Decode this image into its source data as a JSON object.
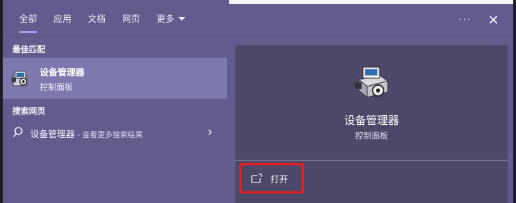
{
  "tabs": [
    {
      "label": "全部",
      "active": true
    },
    {
      "label": "应用"
    },
    {
      "label": "文档"
    },
    {
      "label": "网页"
    },
    {
      "label": "更多"
    }
  ],
  "header": {
    "more_options_glyph": "···",
    "close_glyph": "✕"
  },
  "best_match": {
    "section_title": "最佳匹配",
    "title": "设备管理器",
    "subtitle": "控制面板",
    "icon": "device-manager-icon"
  },
  "web_search": {
    "section_title": "搜索网页",
    "query": "设备管理器",
    "hint": " - 查看更多搜索结果",
    "icon": "search-icon",
    "chevron_glyph": "›"
  },
  "preview": {
    "title": "设备管理器",
    "subtitle": "控制面板",
    "icon": "device-manager-icon",
    "actions": [
      {
        "label": "打开",
        "icon": "open-window-icon"
      }
    ]
  },
  "colors": {
    "panel_bg": "#615b8e",
    "selected_item_bg": "#7d78ad",
    "preview_bg": "#4e4868",
    "tab_underline": "#a39ff0",
    "highlight_box": "#ef1b1b"
  }
}
